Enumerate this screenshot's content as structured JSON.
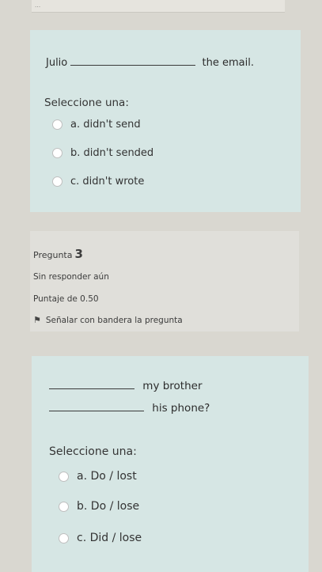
{
  "topstrip": {
    "text": "..."
  },
  "q_prev": {
    "subject": "Julio",
    "rest": "the email.",
    "prompt": "Seleccione una:",
    "options": [
      "a. didn't send",
      "b. didn't sended",
      "c. didn't wrote"
    ]
  },
  "q3": {
    "label": "Pregunta",
    "number": "3",
    "status": "Sin responder aún",
    "score": "Puntaje de 0.50",
    "flag_label": "Señalar con bandera la pregunta",
    "line1_rest": "my brother",
    "line2_rest": "his phone?",
    "prompt": "Seleccione una:",
    "options": [
      "a. Do / lost",
      "b. Do / lose",
      "c. Did / lose"
    ]
  }
}
